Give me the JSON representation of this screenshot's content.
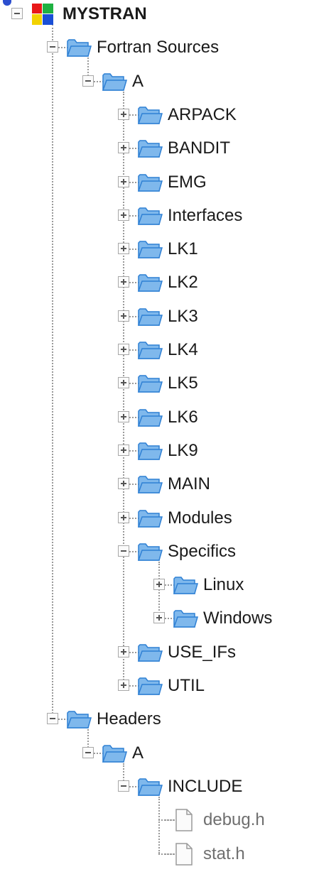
{
  "tree": {
    "root": {
      "label": "MYSTRAN",
      "icon": "mystran-app-icon",
      "expanded": true
    },
    "nodes": [
      {
        "id": "fortran-sources",
        "label": "Fortran Sources",
        "type": "folder",
        "expanded": true
      },
      {
        "id": "fortran-sources-a",
        "label": "A",
        "type": "folder",
        "expanded": true
      },
      {
        "id": "arpack",
        "label": "ARPACK",
        "type": "folder",
        "expanded": false
      },
      {
        "id": "bandit",
        "label": "BANDIT",
        "type": "folder",
        "expanded": false
      },
      {
        "id": "emg",
        "label": "EMG",
        "type": "folder",
        "expanded": false
      },
      {
        "id": "interfaces",
        "label": "Interfaces",
        "type": "folder",
        "expanded": false
      },
      {
        "id": "lk1",
        "label": "LK1",
        "type": "folder",
        "expanded": false
      },
      {
        "id": "lk2",
        "label": "LK2",
        "type": "folder",
        "expanded": false
      },
      {
        "id": "lk3",
        "label": "LK3",
        "type": "folder",
        "expanded": false
      },
      {
        "id": "lk4",
        "label": "LK4",
        "type": "folder",
        "expanded": false
      },
      {
        "id": "lk5",
        "label": "LK5",
        "type": "folder",
        "expanded": false
      },
      {
        "id": "lk6",
        "label": "LK6",
        "type": "folder",
        "expanded": false
      },
      {
        "id": "lk9",
        "label": "LK9",
        "type": "folder",
        "expanded": false
      },
      {
        "id": "main",
        "label": "MAIN",
        "type": "folder",
        "expanded": false
      },
      {
        "id": "modules",
        "label": "Modules",
        "type": "folder",
        "expanded": false
      },
      {
        "id": "specifics",
        "label": "Specifics",
        "type": "folder",
        "expanded": true
      },
      {
        "id": "linux",
        "label": "Linux",
        "type": "folder",
        "expanded": false
      },
      {
        "id": "windows",
        "label": "Windows",
        "type": "folder",
        "expanded": false
      },
      {
        "id": "use-ifs",
        "label": "USE_IFs",
        "type": "folder",
        "expanded": false
      },
      {
        "id": "util",
        "label": "UTIL",
        "type": "folder",
        "expanded": false
      },
      {
        "id": "headers",
        "label": "Headers",
        "type": "folder",
        "expanded": true
      },
      {
        "id": "headers-a",
        "label": "A",
        "type": "folder",
        "expanded": true
      },
      {
        "id": "include",
        "label": "INCLUDE",
        "type": "folder",
        "expanded": true
      },
      {
        "id": "debug-h",
        "label": "debug.h",
        "type": "file"
      },
      {
        "id": "stat-h",
        "label": "stat.h",
        "type": "file"
      }
    ]
  },
  "colors": {
    "folder_fill": "#7fb8ec",
    "folder_edge": "#2f80d4",
    "text": "#1a1a1a",
    "file_text": "#6f6f6f",
    "logo": [
      "#e81818",
      "#1fb141",
      "#f2d200",
      "#1a4fd6"
    ]
  }
}
